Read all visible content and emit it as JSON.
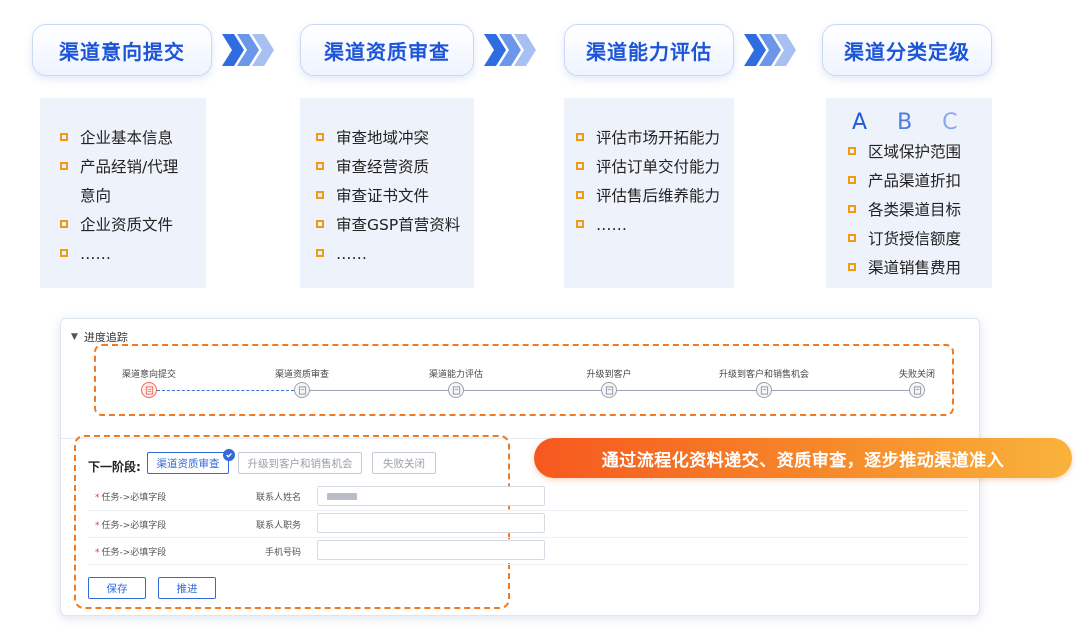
{
  "flow": {
    "stages": [
      {
        "title": "渠道意向提交",
        "items": [
          "企业基本信息",
          "产品经销/代理",
          "意向",
          "企业资质文件",
          "……"
        ]
      },
      {
        "title": "渠道资质审查",
        "items": [
          "审查地域冲突",
          "审查经营资质",
          "审查证书文件",
          "审查GSP首营资料",
          "……"
        ]
      },
      {
        "title": "渠道能力评估",
        "items": [
          "评估市场开拓能力",
          "评估订单交付能力",
          "评估售后维养能力",
          "……"
        ]
      },
      {
        "title": "渠道分类定级",
        "grades": [
          "A",
          "B",
          "C"
        ],
        "items": [
          "区域保护范围",
          "产品渠道折扣",
          "各类渠道目标",
          "订货授信额度",
          "渠道销售费用"
        ]
      }
    ],
    "accent_color": "#1d55d8",
    "bullet_color": "#f29a16"
  },
  "panel": {
    "section_title": "进度追踪",
    "steps": [
      "渠道意向提交",
      "渠道资质审查",
      "渠道能力评估",
      "升级到客户",
      "升级到客户和销售机会",
      "失败关闭"
    ],
    "next_stage_label": "下一阶段:",
    "next_stage_options": [
      "渠道资质审查",
      "升级到客户和销售机会",
      "失败关闭"
    ],
    "form_rows": [
      {
        "task": "任务->必填字段",
        "field": "联系人姓名",
        "value": ""
      },
      {
        "task": "任务->必填字段",
        "field": "联系人职务",
        "value": ""
      },
      {
        "task": "任务->必填字段",
        "field": "手机号码",
        "value": ""
      }
    ],
    "save_label": "保存",
    "advance_label": "推进"
  },
  "callout": "通过流程化资料递交、资质审查，逐步推动渠道准入"
}
